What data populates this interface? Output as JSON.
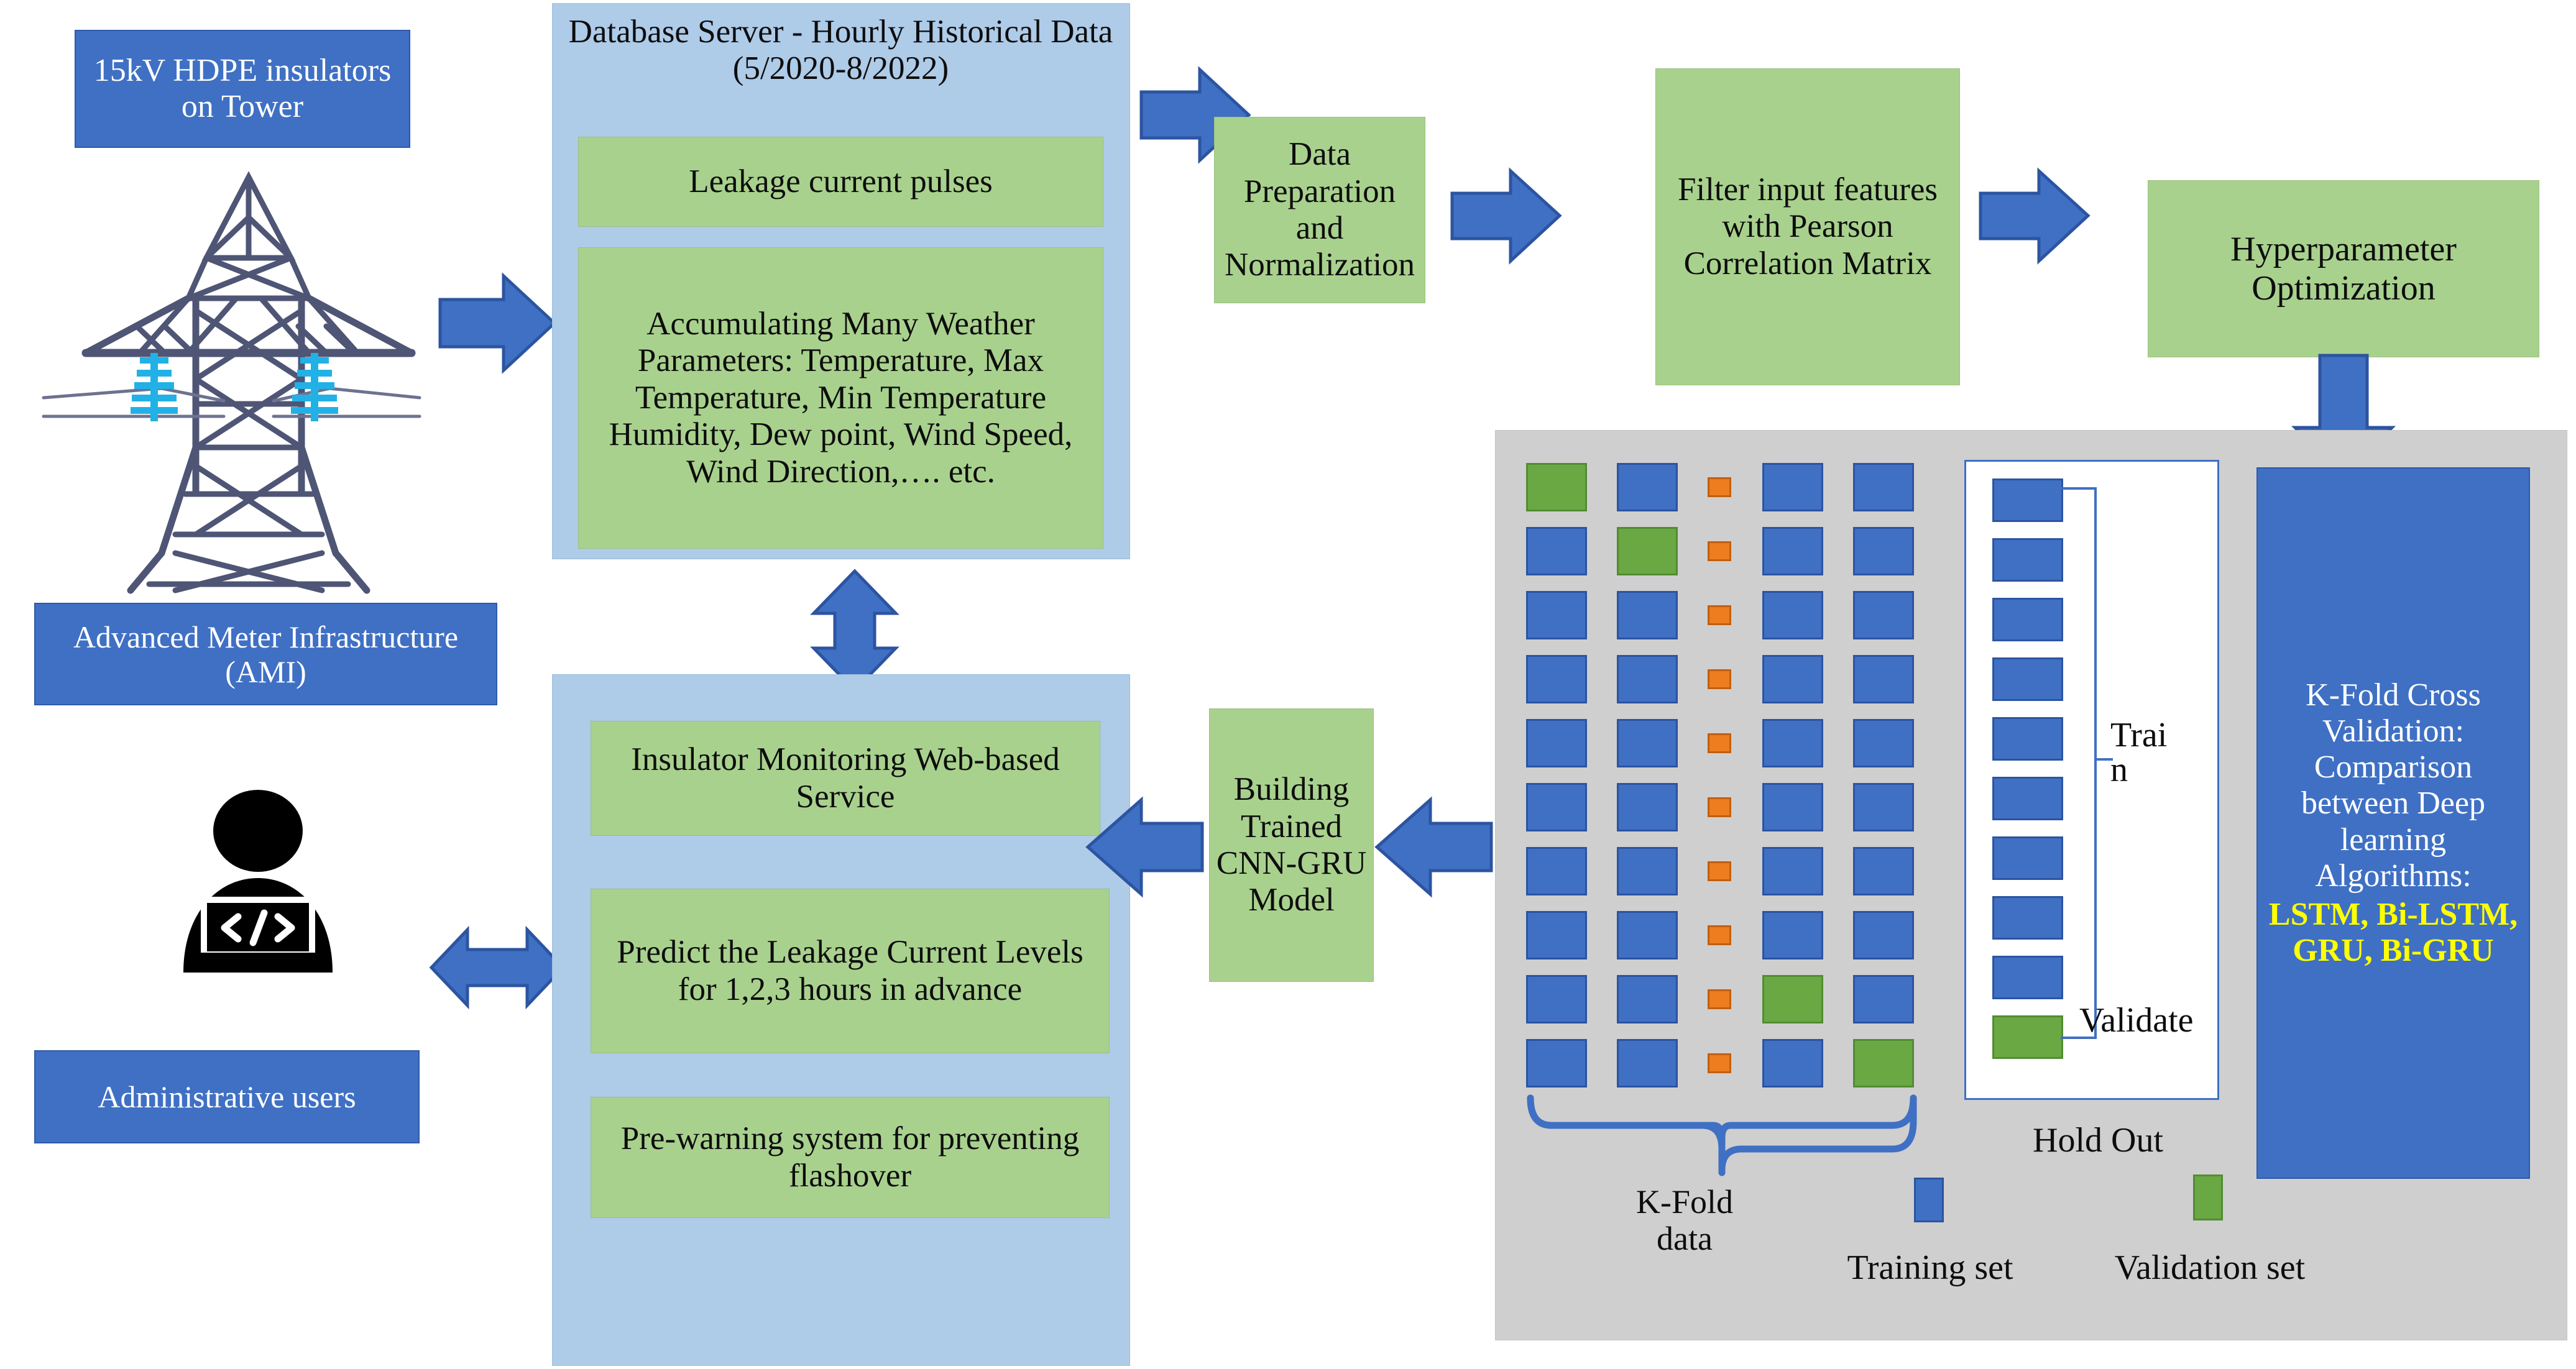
{
  "left_column": {
    "source_box": "15kV HDPE insulators on Tower",
    "tower_icon": "transmission-tower-icon",
    "ami_box": "Advanced Meter Infrastructure (AMI)",
    "user_icon": "developer-at-laptop-icon",
    "admin_box": "Administrative users"
  },
  "database_panel": {
    "title": "Database Server - Hourly Historical Data (5/2020-8/2022)",
    "items": [
      "Leakage current pulses",
      "Accumulating Many Weather Parameters: Temperature, Max Temperature, Min Temperature Humidity, Dew point, Wind Speed, Wind Direction,…. etc."
    ]
  },
  "pipeline": {
    "data_preparation": "Data Preparation and Normalization",
    "feature_filter": "Filter input features with Pearson Correlation Matrix",
    "hyperparameter": "Hyperparameter Optimization",
    "model_building": "Building Trained CNN-GRU Model"
  },
  "service_panel": {
    "items": [
      "Insulator Monitoring Web-based Service",
      "Predict the Leakage Current Levels for 1,2,3 hours in advance",
      "Pre-warning system for preventing flashover"
    ]
  },
  "validation_panel": {
    "kfold_caption_line1": "K-Fold",
    "kfold_caption_line2": "data",
    "holdout_caption": "Hold Out",
    "train_label": "Trai\nn",
    "validate_label": "Validate",
    "legend": [
      {
        "label": "Training set",
        "color": "#3f70c4"
      },
      {
        "label": "Validation set",
        "color": "#6aa843"
      }
    ],
    "info_box": {
      "text": "K-Fold Cross Validation: Comparison between Deep learning Algorithms:",
      "highlight": "LSTM, Bi-LSTM, GRU, Bi-GRU",
      "highlight_color": "#ffff00"
    }
  },
  "chart_data": {
    "type": "heatmap",
    "title": "K-Fold Cross Validation layout",
    "rows": 10,
    "columns": 4,
    "ellipsis_column_index": 2,
    "legend": [
      "Training set",
      "Validation set"
    ],
    "colors": {
      "training": "#3f70c4",
      "validation": "#6aa843",
      "ellipsis": "#ed7d1f"
    },
    "grid": [
      [
        "validation",
        "training",
        "training",
        "training"
      ],
      [
        "training",
        "validation",
        "training",
        "training"
      ],
      [
        "training",
        "training",
        "training",
        "training"
      ],
      [
        "training",
        "training",
        "training",
        "training"
      ],
      [
        "training",
        "training",
        "training",
        "training"
      ],
      [
        "training",
        "training",
        "training",
        "training"
      ],
      [
        "training",
        "training",
        "training",
        "training"
      ],
      [
        "training",
        "training",
        "training",
        "training"
      ],
      [
        "training",
        "training",
        "validation",
        "training"
      ],
      [
        "training",
        "training",
        "training",
        "validation"
      ]
    ],
    "holdout": {
      "rows": 10,
      "values": [
        "training",
        "training",
        "training",
        "training",
        "training",
        "training",
        "training",
        "training",
        "training",
        "validation"
      ]
    }
  },
  "colors": {
    "accent_blue": "#3f70c4",
    "light_blue_panel": "#aecbe8",
    "green_box": "#a9d18e",
    "gray_panel": "#cfcfcf",
    "orange": "#ed7d1f",
    "tower_gray": "#4f5575",
    "insulator_cyan": "#22b1e6"
  }
}
